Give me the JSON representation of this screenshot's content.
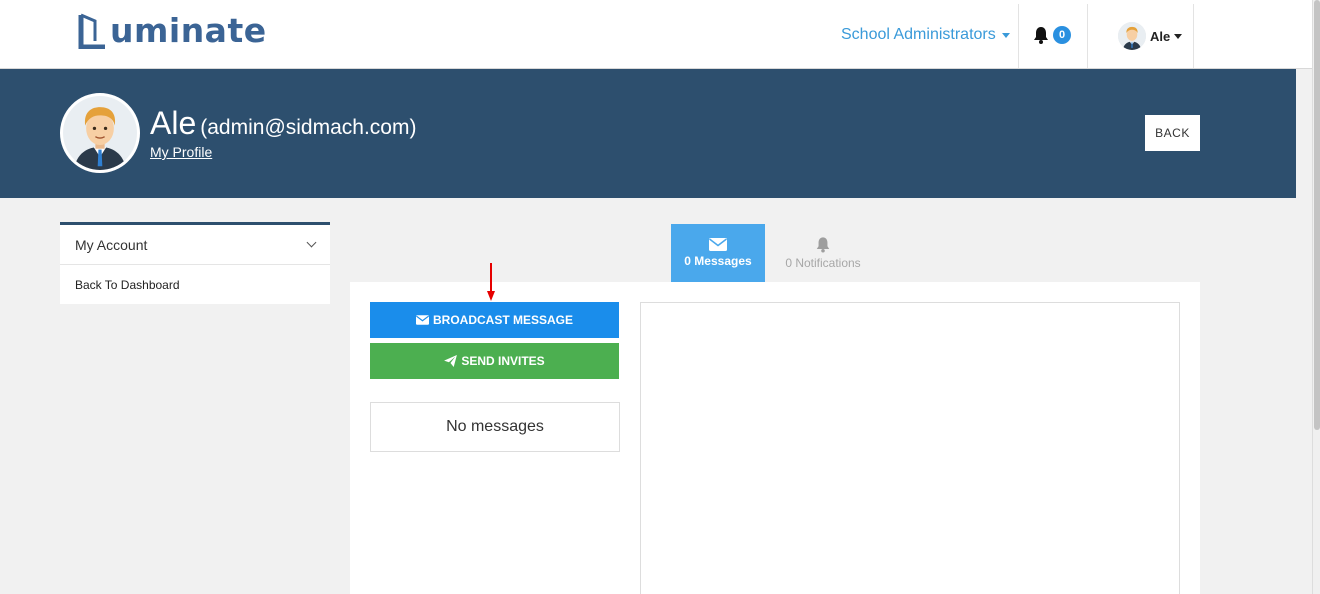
{
  "brand": {
    "name": "uminate",
    "logo_letter": "L"
  },
  "nav": {
    "role_menu": "School Administrators",
    "notification_count": "0",
    "user_name": "Ale"
  },
  "banner": {
    "name": "Ale",
    "email": "(admin@sidmach.com)",
    "profile_link": "My Profile",
    "back_label": "BACK"
  },
  "sidebar": {
    "header": "My Account",
    "items": [
      {
        "label": "Back To Dashboard"
      }
    ]
  },
  "tabs": [
    {
      "label": "0 Messages",
      "icon": "envelope-icon",
      "active": true
    },
    {
      "label": "0 Notifications",
      "icon": "bell-icon",
      "active": false
    }
  ],
  "actions": {
    "broadcast_label": "BROADCAST MESSAGE",
    "invite_label": "SEND INVITES"
  },
  "messages": {
    "empty_text": "No messages"
  },
  "colors": {
    "banner": "#2d4f6e",
    "accent": "#1a8deb",
    "success": "#4caf50",
    "tab_active": "#4aa8ec",
    "annotation": "#e60000"
  }
}
